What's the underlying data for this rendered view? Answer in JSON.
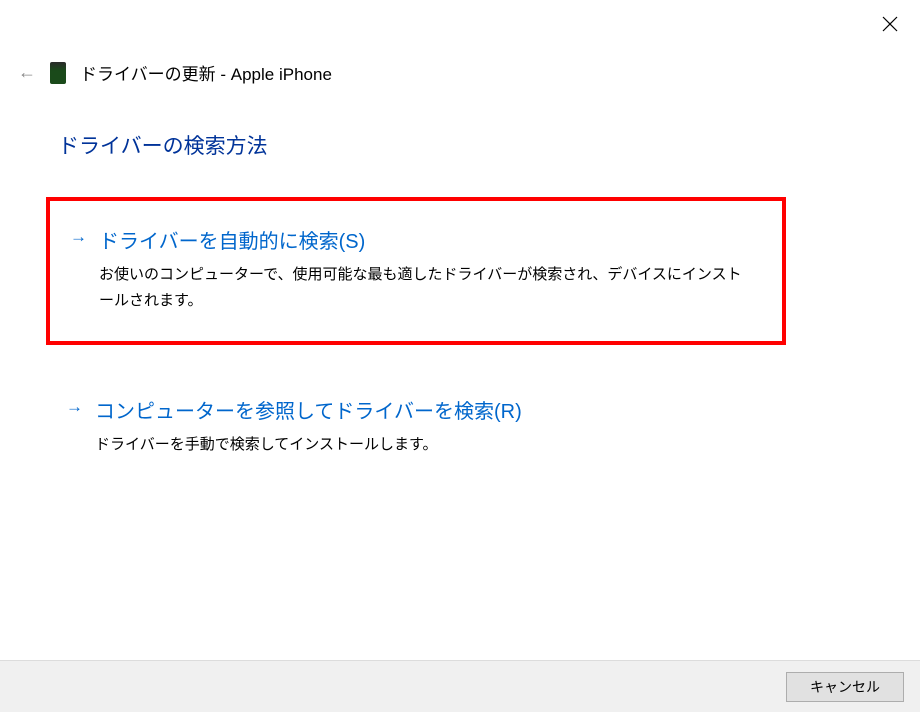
{
  "window": {
    "title": "ドライバーの更新 - Apple iPhone"
  },
  "heading": "ドライバーの検索方法",
  "options": {
    "auto": {
      "title": "ドライバーを自動的に検索(S)",
      "desc": "お使いのコンピューターで、使用可能な最も適したドライバーが検索され、デバイスにインストールされます。"
    },
    "manual": {
      "title": "コンピューターを参照してドライバーを検索(R)",
      "desc": "ドライバーを手動で検索してインストールします。"
    }
  },
  "buttons": {
    "cancel": "キャンセル"
  }
}
